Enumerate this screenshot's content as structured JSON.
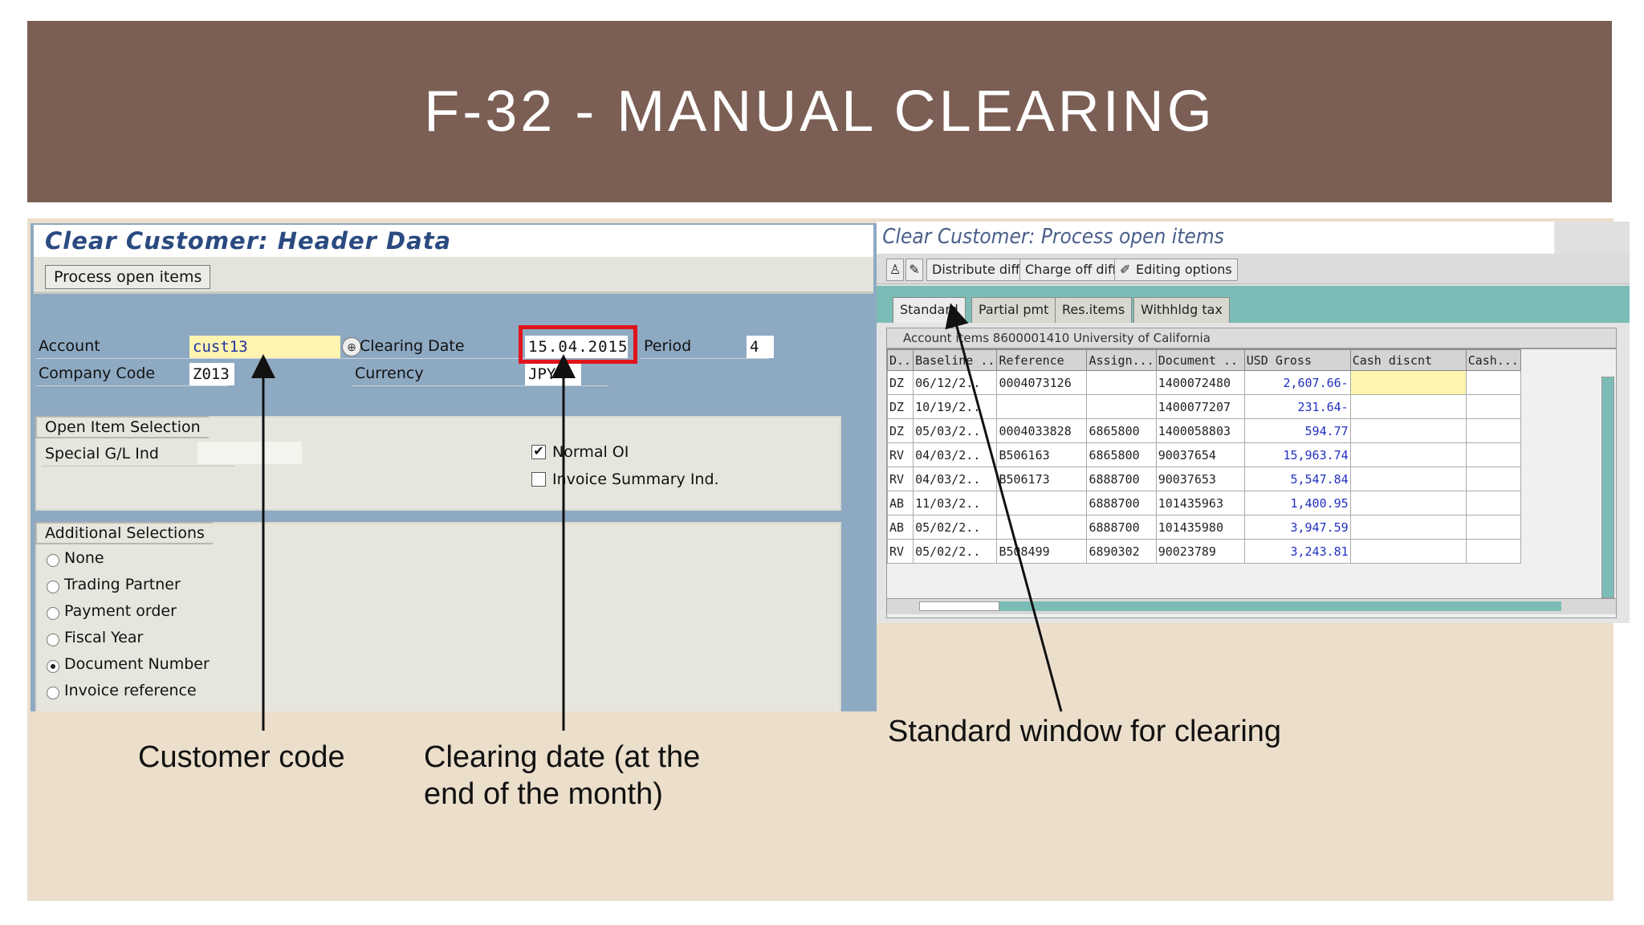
{
  "slide": {
    "title": "F-32 - MANUAL CLEARING"
  },
  "header_screen": {
    "title": "Clear Customer: Header Data",
    "process_button": "Process open items",
    "fields": {
      "account_label": "Account",
      "account_value": "cust13",
      "clearing_date_label": "Clearing Date",
      "clearing_date_value": "15.04.2015",
      "period_label": "Period",
      "period_value": "4",
      "company_code_label": "Company Code",
      "company_code_value": "Z013",
      "currency_label": "Currency",
      "currency_value": "JPY"
    },
    "open_item_selection": {
      "title": "Open Item Selection",
      "special_gl_label": "Special G/L Ind",
      "special_gl_value": "",
      "normal_oi_label": "Normal OI",
      "normal_oi_checked": true,
      "invoice_summary_label": "Invoice Summary Ind.",
      "invoice_summary_checked": false
    },
    "additional_selections": {
      "title": "Additional Selections",
      "options": [
        "None",
        "Trading Partner",
        "Payment order",
        "Fiscal Year",
        "Document Number",
        "Invoice reference"
      ],
      "selected": "Document Number"
    }
  },
  "process_screen": {
    "title": "Clear Customer: Process open items",
    "toolbar": {
      "distribute_diff": "Distribute diff.",
      "charge_off_diff": "Charge off diff.",
      "editing_options": "Editing options"
    },
    "tabs": [
      "Standard",
      "Partial pmt",
      "Res.items",
      "Withhldg tax"
    ],
    "active_tab": "Standard",
    "caption": "Account items 8600001410 University of California",
    "columns": [
      "D..",
      "Baseline ..",
      "Reference",
      "Assign...",
      "Document ..",
      "USD Gross",
      "Cash discnt",
      "Cash..."
    ],
    "rows": [
      [
        "DZ",
        "06/12/2..",
        "0004073126",
        "",
        "1400072480",
        "2,607.66-",
        "",
        ""
      ],
      [
        "DZ",
        "10/19/2..",
        "",
        "",
        "1400077207",
        "231.64-",
        "",
        ""
      ],
      [
        "DZ",
        "05/03/2..",
        "0004033828",
        "6865800",
        "1400058803",
        "594.77",
        "",
        ""
      ],
      [
        "RV",
        "04/03/2..",
        "B506163",
        "6865800",
        "90037654",
        "15,963.74",
        "",
        ""
      ],
      [
        "RV",
        "04/03/2..",
        "B506173",
        "6888700",
        "90037653",
        "5,547.84",
        "",
        ""
      ],
      [
        "AB",
        "11/03/2..",
        "",
        "6888700",
        "101435963",
        "1,400.95",
        "",
        ""
      ],
      [
        "AB",
        "05/02/2..",
        "",
        "6888700",
        "101435980",
        "3,947.59",
        "",
        ""
      ],
      [
        "RV",
        "05/02/2..",
        "B508499",
        "6890302",
        "90023789",
        "3,243.81",
        "",
        ""
      ]
    ]
  },
  "annotations": {
    "customer_code": "Customer code",
    "clearing_date_line1": "Clearing date (at the",
    "clearing_date_line2": "end of the month)",
    "standard_window": "Standard window for clearing"
  },
  "colors": {
    "title_band": "#7b5e54",
    "content_bg": "#ebdecb",
    "sap_blue": "#8ea9c2",
    "highlight_red": "#e0151b",
    "teal": "#7bbdb6"
  }
}
